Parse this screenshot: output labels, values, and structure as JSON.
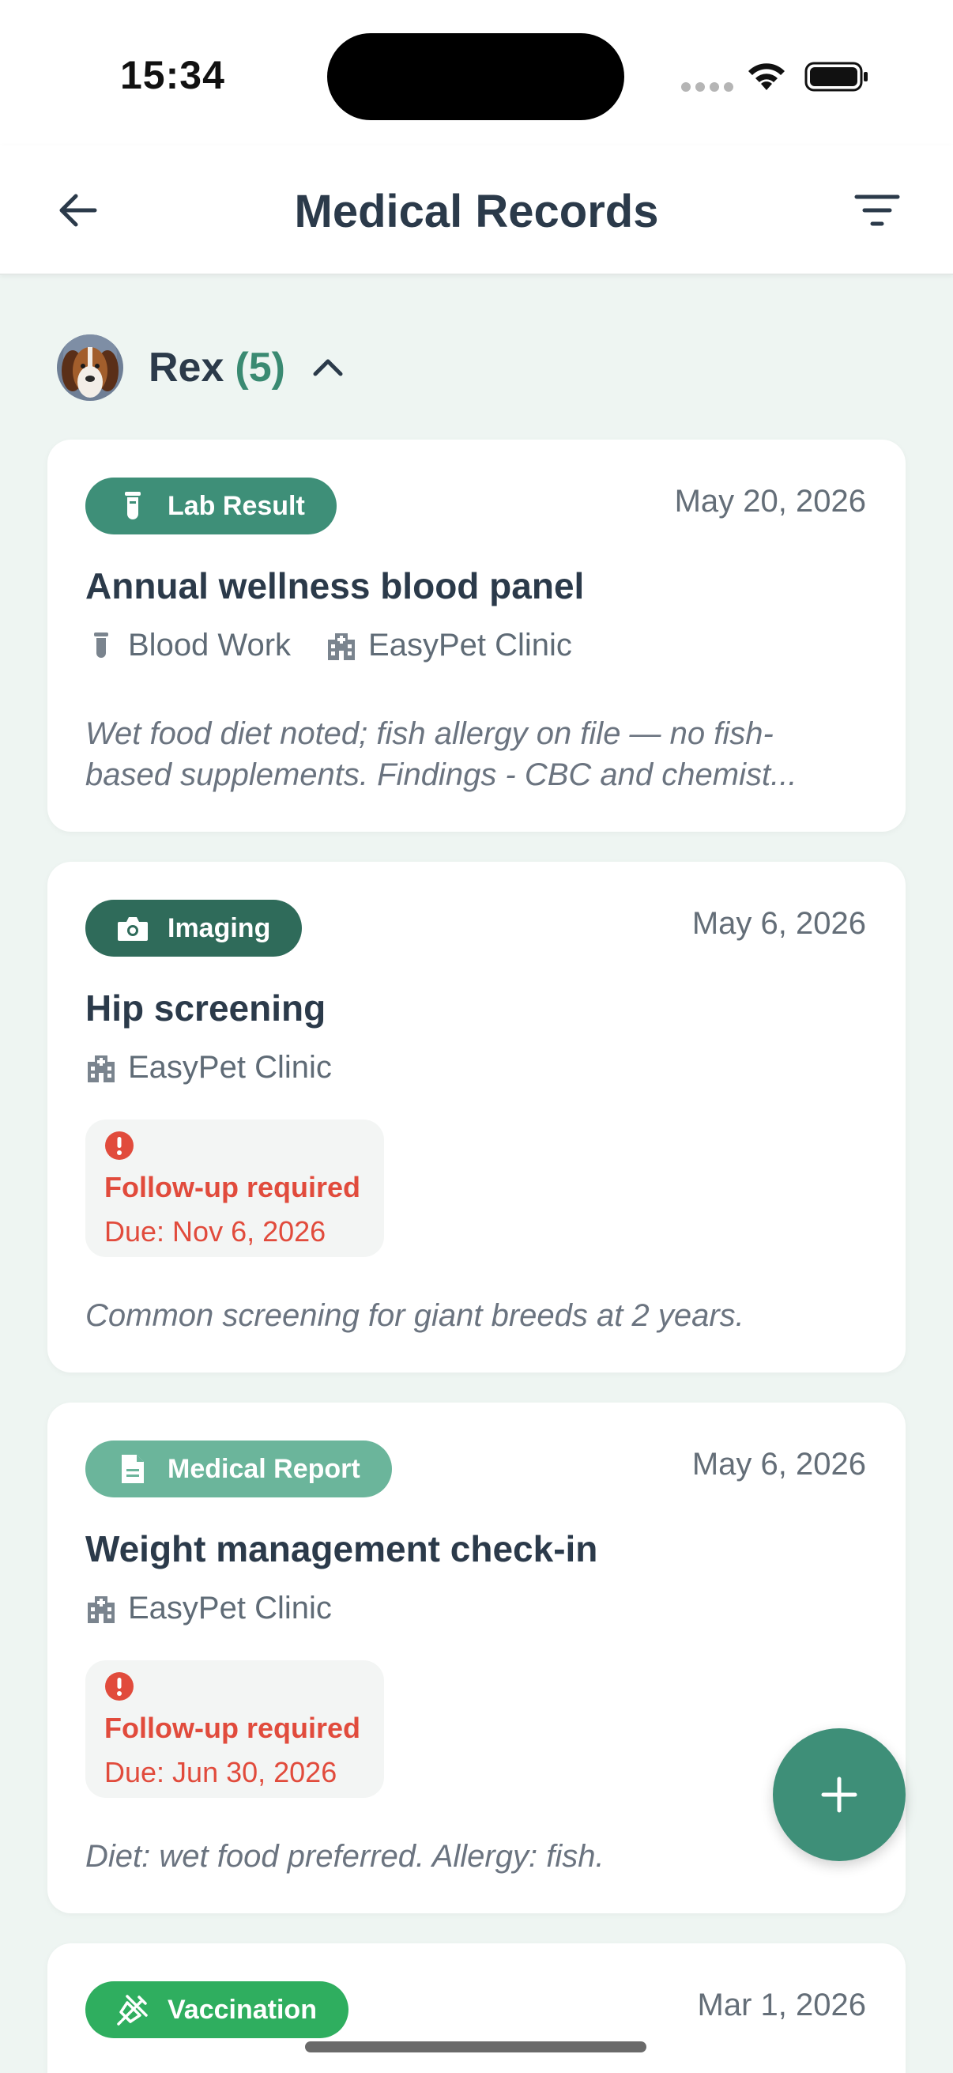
{
  "status_bar": {
    "time": "15:34"
  },
  "header": {
    "title": "Medical Records"
  },
  "pet": {
    "name": "Rex",
    "count": "(5)"
  },
  "records": [
    {
      "badge": "Lab Result",
      "badge_color": "#3e8f78",
      "badge_icon": "test-tube-icon",
      "date": "May 20, 2026",
      "title": "Annual wellness blood panel",
      "category": "Blood Work",
      "clinic": "EasyPet Clinic",
      "note_line1": "Wet food diet noted; fish allergy on file — no fish-",
      "note_line2": "based supplements. Findings - CBC and chemist..."
    },
    {
      "badge": "Imaging",
      "badge_color": "#2f6b5a",
      "badge_icon": "camera-icon",
      "date": "May 6, 2026",
      "title": "Hip screening",
      "clinic": "EasyPet Clinic",
      "followup_title": "Follow-up required",
      "followup_due": "Due: Nov 6, 2026",
      "note_line1": "Common screening for giant breeds at 2 years."
    },
    {
      "badge": "Medical Report",
      "badge_color": "#6bb59b",
      "badge_icon": "document-icon",
      "date": "May 6, 2026",
      "title": "Weight management check-in",
      "clinic": "EasyPet Clinic",
      "followup_title": "Follow-up required",
      "followup_due": "Due: Jun 30, 2026",
      "note_line1": "Diet: wet food preferred. Allergy: fish."
    },
    {
      "badge": "Vaccination",
      "badge_color": "#2fae5f",
      "badge_icon": "syringe-icon",
      "date": "Mar 1, 2026"
    }
  ],
  "colors": {
    "accent": "#3e8f78",
    "alert": "#e14b3c",
    "background": "#eef5f2"
  }
}
